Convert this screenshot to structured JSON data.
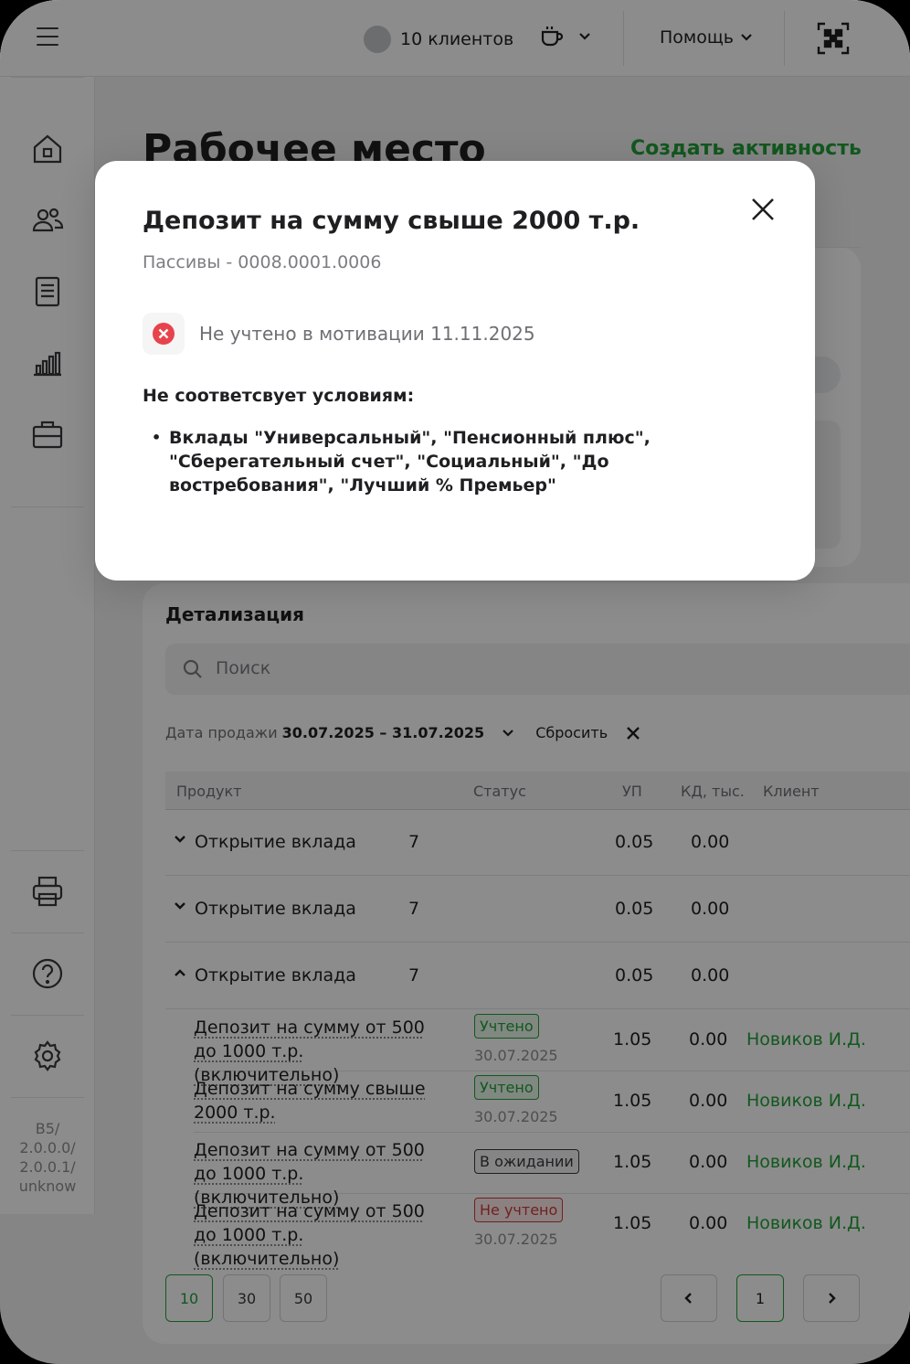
{
  "topbar": {
    "clients_label": "10 клиентов",
    "help_label": "Помощь"
  },
  "sidebar": {
    "version": [
      "B5/",
      "2.0.0.0/",
      "2.0.0.1/",
      "unknow"
    ]
  },
  "page": {
    "title": "Рабочее место",
    "create_activity": "Создать активность"
  },
  "detail": {
    "title": "Детализация",
    "search_placeholder": "Поиск",
    "filter_label": "Дата продажи",
    "filter_value": "30.07.2025 – 31.07.2025",
    "reset_label": "Сбросить",
    "columns": [
      "Продукт",
      "Статус",
      "УП",
      "КД, тыс.",
      "Клиент"
    ],
    "groups": [
      {
        "name": "Открытие вклада",
        "count": "7",
        "up": "0.05",
        "kd": "0.00"
      },
      {
        "name": "Открытие вклада",
        "count": "7",
        "up": "0.05",
        "kd": "0.00"
      },
      {
        "name": "Открытие вклада",
        "count": "7",
        "up": "0.05",
        "kd": "0.00"
      }
    ],
    "rows": [
      {
        "product": "Депозит на сумму от 500 до 1000 т.р. (включительно)",
        "status": "Учтено",
        "date": "30.07.2025",
        "up": "1.05",
        "kd": "0.00",
        "client": "Новиков И.Д."
      },
      {
        "product": "Депозит на сумму свыше 2000 т.р.",
        "status": "Учтено",
        "date": "30.07.2025",
        "up": "1.05",
        "kd": "0.00",
        "client": "Новиков И.Д."
      },
      {
        "product": "Депозит на сумму от 500 до 1000 т.р. (включительно)",
        "status": "В ожидании",
        "date": "",
        "up": "1.05",
        "kd": "0.00",
        "client": "Новиков И.Д."
      },
      {
        "product": "Депозит на сумму от 500 до 1000 т.р. (включительно)",
        "status": "Не учтено",
        "date": "30.07.2025",
        "up": "1.05",
        "kd": "0.00",
        "client": "Новиков И.Д."
      }
    ],
    "page_sizes": [
      "10",
      "30",
      "50"
    ],
    "current_page": "1"
  },
  "modal": {
    "title": "Депозит на сумму свыше 2000 т.р.",
    "subtitle": "Пассивы - 0008.0001.0006",
    "status_text": "Не учтено в мотивации 11.11.2025",
    "conditions_label": "Не соответсвует условиям:",
    "conditions": [
      "Вклады \"Универсальный\", \"Пенсионный плюс\", \"Сберегательный счет\", \"Социальный\", \"До востребования\", \"Лучший % Премьер\""
    ]
  },
  "colors": {
    "accent_green": "#21a038",
    "error_red": "#e8434d",
    "overlay": "rgba(0,0,0,0.45)"
  },
  "icons": [
    "menu-icon",
    "coffee-cup-icon",
    "chevron-down-icon",
    "qr-scan-icon",
    "home-icon",
    "users-icon",
    "document-icon",
    "bar-chart-icon",
    "briefcase-icon",
    "printer-icon",
    "help-icon",
    "gear-icon",
    "search-icon",
    "close-icon",
    "error-circle-icon",
    "chevron-left-icon",
    "chevron-right-icon"
  ]
}
